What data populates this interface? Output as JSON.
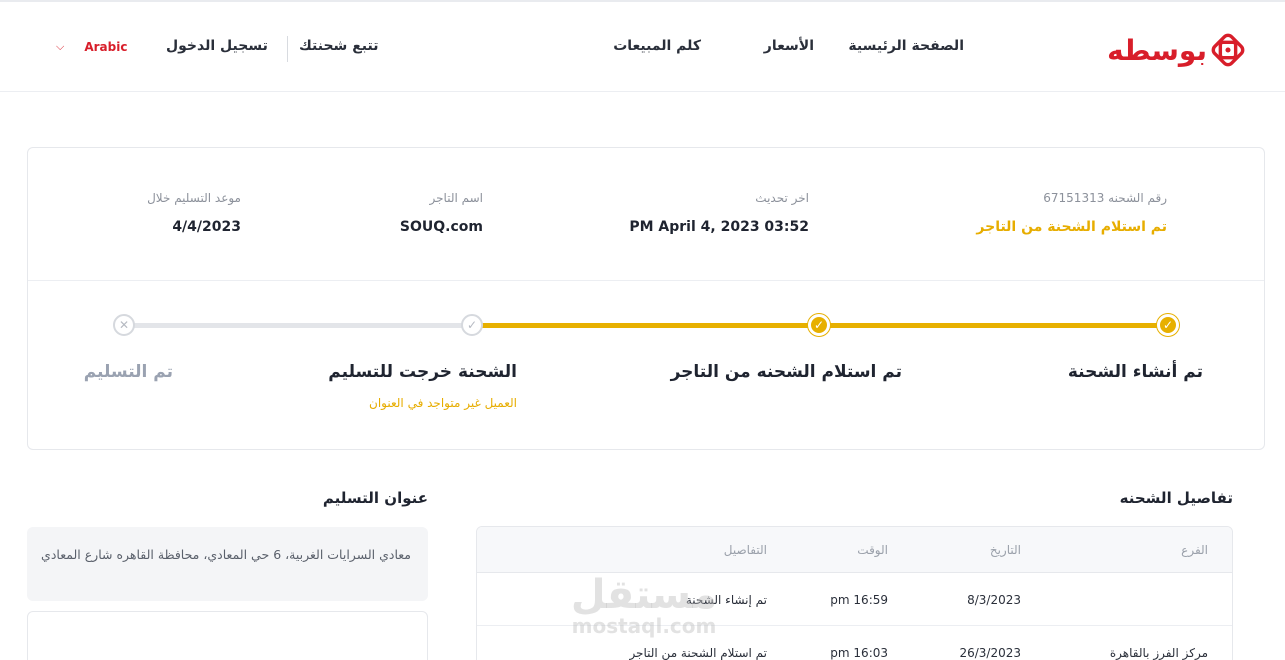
{
  "header": {
    "logo_text": "بوسطه",
    "nav": {
      "home": "الصفحة الرئيسية",
      "prices": "الأسعار",
      "sales": "كلم المبيعات",
      "track": "تتبع شحنتك",
      "login": "تسجيل الدخول"
    },
    "language": "Arabic"
  },
  "shipment": {
    "number_label": "رقم الشحنه 67151313",
    "status": "تم استلام الشحنة من التاجر",
    "last_update_label": "اخر تحديث",
    "last_update_value": "PM April 4, 2023 03:52",
    "merchant_label": "اسم التاجر",
    "merchant_value": "SOUQ.com",
    "delivery_label": "موعد التسليم خلال",
    "delivery_value": "4/4/2023"
  },
  "steps": [
    {
      "title": "تم أنشاء الشحنة",
      "state": "done"
    },
    {
      "title": "تم استلام الشحنه من التاجر",
      "state": "done"
    },
    {
      "title": "الشحنة خرجت للتسليم",
      "note": "العميل غير متواجد في العنوان",
      "state": "pending"
    },
    {
      "title": "تم التسليم",
      "state": "failed"
    }
  ],
  "details": {
    "title": "تفاصيل الشحنه",
    "columns": {
      "branch": "الفرع",
      "date": "التاريخ",
      "time": "الوقت",
      "details": "التفاصيل"
    },
    "rows": [
      {
        "branch": "",
        "date": "8/3/2023",
        "time": "pm 16:59",
        "details": "تم إنشاء الشحنة"
      },
      {
        "branch": "مركز الفرز بالقاهرة",
        "date": "26/3/2023",
        "time": "pm 16:03",
        "details": "تم استلام الشحنة من التاجر"
      }
    ]
  },
  "address": {
    "title": "عنوان التسليم",
    "text": "معادي السرايات الغربية، 6 حي المعادي، محافظة القاهره شارع المعادي"
  },
  "watermark": {
    "arabic": "مستقل",
    "latin": "mostaql.com"
  },
  "colors": {
    "brand": "#d81e2a",
    "accent": "#e7b000",
    "track_gray": "#e3e5e9"
  }
}
